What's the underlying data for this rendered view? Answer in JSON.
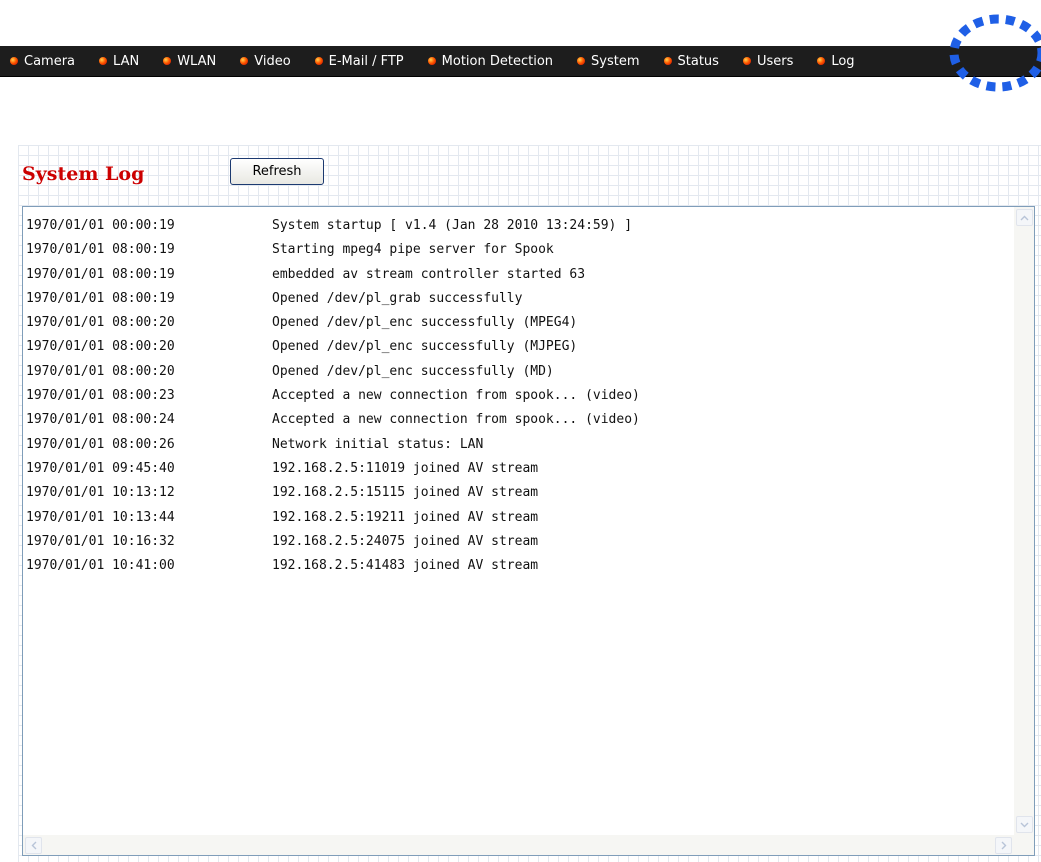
{
  "nav": {
    "items": [
      {
        "label": "Camera"
      },
      {
        "label": "LAN"
      },
      {
        "label": "WLAN"
      },
      {
        "label": "Video"
      },
      {
        "label": "E-Mail / FTP"
      },
      {
        "label": "Motion Detection"
      },
      {
        "label": "System"
      },
      {
        "label": "Status"
      },
      {
        "label": "Users"
      },
      {
        "label": "Log"
      }
    ]
  },
  "page": {
    "title": "System Log",
    "refresh_label": "Refresh"
  },
  "log": {
    "entries": [
      {
        "time": "1970/01/01 00:00:19",
        "message": "System startup [ v1.4 (Jan 28 2010 13:24:59) ]"
      },
      {
        "time": "1970/01/01 08:00:19",
        "message": "Starting mpeg4 pipe server for Spook"
      },
      {
        "time": "1970/01/01 08:00:19",
        "message": "embedded av stream controller started 63"
      },
      {
        "time": "1970/01/01 08:00:19",
        "message": "Opened /dev/pl_grab successfully"
      },
      {
        "time": "1970/01/01 08:00:20",
        "message": "Opened /dev/pl_enc successfully (MPEG4)"
      },
      {
        "time": "1970/01/01 08:00:20",
        "message": "Opened /dev/pl_enc successfully (MJPEG)"
      },
      {
        "time": "1970/01/01 08:00:20",
        "message": "Opened /dev/pl_enc successfully (MD)"
      },
      {
        "time": "1970/01/01 08:00:23",
        "message": "Accepted a new connection from spook... (video)"
      },
      {
        "time": "1970/01/01 08:00:24",
        "message": "Accepted a new connection from spook... (video)"
      },
      {
        "time": "1970/01/01 08:00:26",
        "message": "Network initial status: LAN"
      },
      {
        "time": "1970/01/01 09:45:40",
        "message": "192.168.2.5:11019 joined AV stream"
      },
      {
        "time": "1970/01/01 10:13:12",
        "message": "192.168.2.5:15115 joined AV stream"
      },
      {
        "time": "1970/01/01 10:13:44",
        "message": "192.168.2.5:19211 joined AV stream"
      },
      {
        "time": "1970/01/01 10:16:32",
        "message": "192.168.2.5:24075 joined AV stream"
      },
      {
        "time": "1970/01/01 10:41:00",
        "message": "192.168.2.5:41483 joined AV stream"
      }
    ]
  },
  "colors": {
    "nav_background": "#1d1d1d",
    "title_red": "#cc0000",
    "highlight_blue": "#1f5fe6",
    "bullet_red": "#ff3a00"
  },
  "icons": {
    "nav_bullet": "red-bullet-icon",
    "scroll_up": "arrow-up-icon",
    "scroll_down": "arrow-down-icon",
    "scroll_left": "arrow-left-icon",
    "scroll_right": "arrow-right-icon"
  }
}
